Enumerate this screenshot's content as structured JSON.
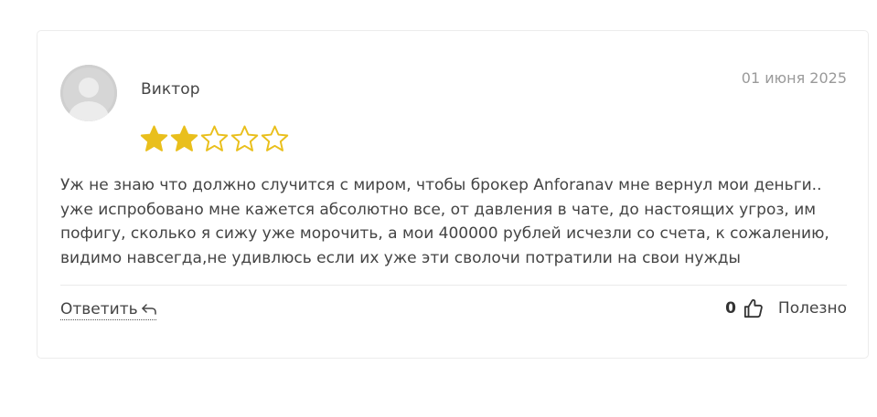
{
  "review": {
    "author": "Виктор",
    "date": "01 июня 2025",
    "rating": 2,
    "rating_max": 5,
    "star_color": "#e9bf1c",
    "text": "Уж не знаю что должно случится с миром, чтобы брокер Anforanav мне вернул мои деньги.. уже испробовано мне кажется абсолютно все, от давления в чате, до настоящих угроз, им пофигу, сколько я сижу уже морочить, а мои 400000 рублей исчезли со счета, к сожалению, видимо навсегда,не удивлюсь если их уже эти сволочи потратили на свои нужды"
  },
  "actions": {
    "reply_label": "Ответить",
    "reply_icon": "reply-arrow-icon",
    "like_count": "0",
    "like_icon": "thumbs-up-icon",
    "useful_label": "Полезно"
  }
}
